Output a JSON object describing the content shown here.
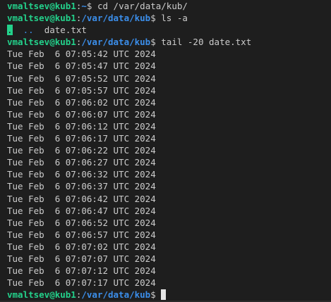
{
  "prompts": [
    {
      "user": "vmaltsev@kub1",
      "path": "~",
      "symbol": "$",
      "command": "cd /var/data/kub/"
    },
    {
      "user": "vmaltsev@kub1",
      "path": "/var/data/kub",
      "symbol": "$",
      "command": "ls -a"
    },
    {
      "user": "vmaltsev@kub1",
      "path": "/var/data/kub",
      "symbol": "$",
      "command": "tail -20 date.txt"
    },
    {
      "user": "vmaltsev@kub1",
      "path": "/var/data/kub",
      "symbol": "$",
      "command": ""
    }
  ],
  "ls_output": {
    "entry_dot": ".",
    "entry_dotdot": "..",
    "entry_file": "date.txt"
  },
  "tail_output": [
    "Tue Feb  6 07:05:42 UTC 2024",
    "Tue Feb  6 07:05:47 UTC 2024",
    "Tue Feb  6 07:05:52 UTC 2024",
    "Tue Feb  6 07:05:57 UTC 2024",
    "Tue Feb  6 07:06:02 UTC 2024",
    "Tue Feb  6 07:06:07 UTC 2024",
    "Tue Feb  6 07:06:12 UTC 2024",
    "Tue Feb  6 07:06:17 UTC 2024",
    "Tue Feb  6 07:06:22 UTC 2024",
    "Tue Feb  6 07:06:27 UTC 2024",
    "Tue Feb  6 07:06:32 UTC 2024",
    "Tue Feb  6 07:06:37 UTC 2024",
    "Tue Feb  6 07:06:42 UTC 2024",
    "Tue Feb  6 07:06:47 UTC 2024",
    "Tue Feb  6 07:06:52 UTC 2024",
    "Tue Feb  6 07:06:57 UTC 2024",
    "Tue Feb  6 07:07:02 UTC 2024",
    "Tue Feb  6 07:07:07 UTC 2024",
    "Tue Feb  6 07:07:12 UTC 2024",
    "Tue Feb  6 07:07:17 UTC 2024"
  ],
  "colors": {
    "background": "#1e1e1e",
    "user": "#23d18b",
    "path": "#3b8eea",
    "text": "#cccccc"
  }
}
